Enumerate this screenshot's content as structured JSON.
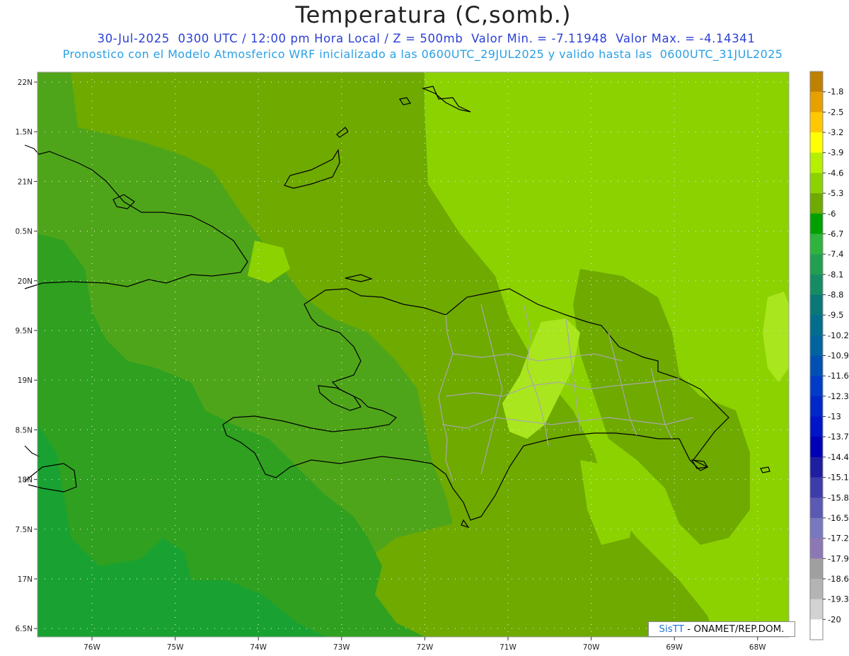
{
  "header": {
    "title": "Temperatura (C,somb.)",
    "line1": "30-Jul-2025  0300 UTC / 12:00 pm Hora Local / Z = 500mb  Valor Min. = -7.11948  Valor Max. = -4.14341",
    "line2": "Pronostico con el Modelo Atmosferico WRF inicializado a las 0600UTC_29JUL2025 y valido hasta las  0600UTC_31JUL2025"
  },
  "axes": {
    "lat_labels": [
      "22N",
      "1.5N",
      "21N",
      "0.5N",
      "20N",
      "9.5N",
      "19N",
      "8.5N",
      "18N",
      "7.5N",
      "17N",
      "6.5N"
    ],
    "lon_labels": [
      "76W",
      "75W",
      "74W",
      "73W",
      "72W",
      "71W",
      "70W",
      "69W",
      "68W"
    ]
  },
  "colorbar": {
    "labels": [
      "-1.8",
      "-2.5",
      "-3.2",
      "-3.9",
      "-4.6",
      "-5.3",
      "-6",
      "-6.7",
      "-7.4",
      "-8.1",
      "-8.8",
      "-9.5",
      "-10.2",
      "-10.9",
      "-11.6",
      "-12.3",
      "-13",
      "-13.7",
      "-14.4",
      "-15.1",
      "-15.8",
      "-16.5",
      "-17.2",
      "-17.9",
      "-18.6",
      "-19.3",
      "-20"
    ],
    "colors": [
      "#c08000",
      "#e6a000",
      "#ffc800",
      "#ffff00",
      "#b4f000",
      "#8cd200",
      "#6eaa00",
      "#00a000",
      "#2db43c",
      "#20a050",
      "#168c64",
      "#0a7878",
      "#006e8c",
      "#0064a0",
      "#0050b4",
      "#003cc8",
      "#0028c8",
      "#0014c8",
      "#0000b4",
      "#1e1ea0",
      "#3c3caa",
      "#5a5ab4",
      "#7878be",
      "#8c78b4",
      "#a0a0a0",
      "#b4b4b4",
      "#d2d2d2",
      "#ffffff"
    ]
  },
  "field_colors": {
    "warm": "#8cd200",
    "mid": "#6eaa00",
    "cool": "#4fa51a",
    "cold": "#2fa020",
    "coldest": "#19a231",
    "bright": "#a9e61e"
  },
  "credit": {
    "brand": "SisTT",
    "text": " - ONAMET/REP.DOM."
  }
}
